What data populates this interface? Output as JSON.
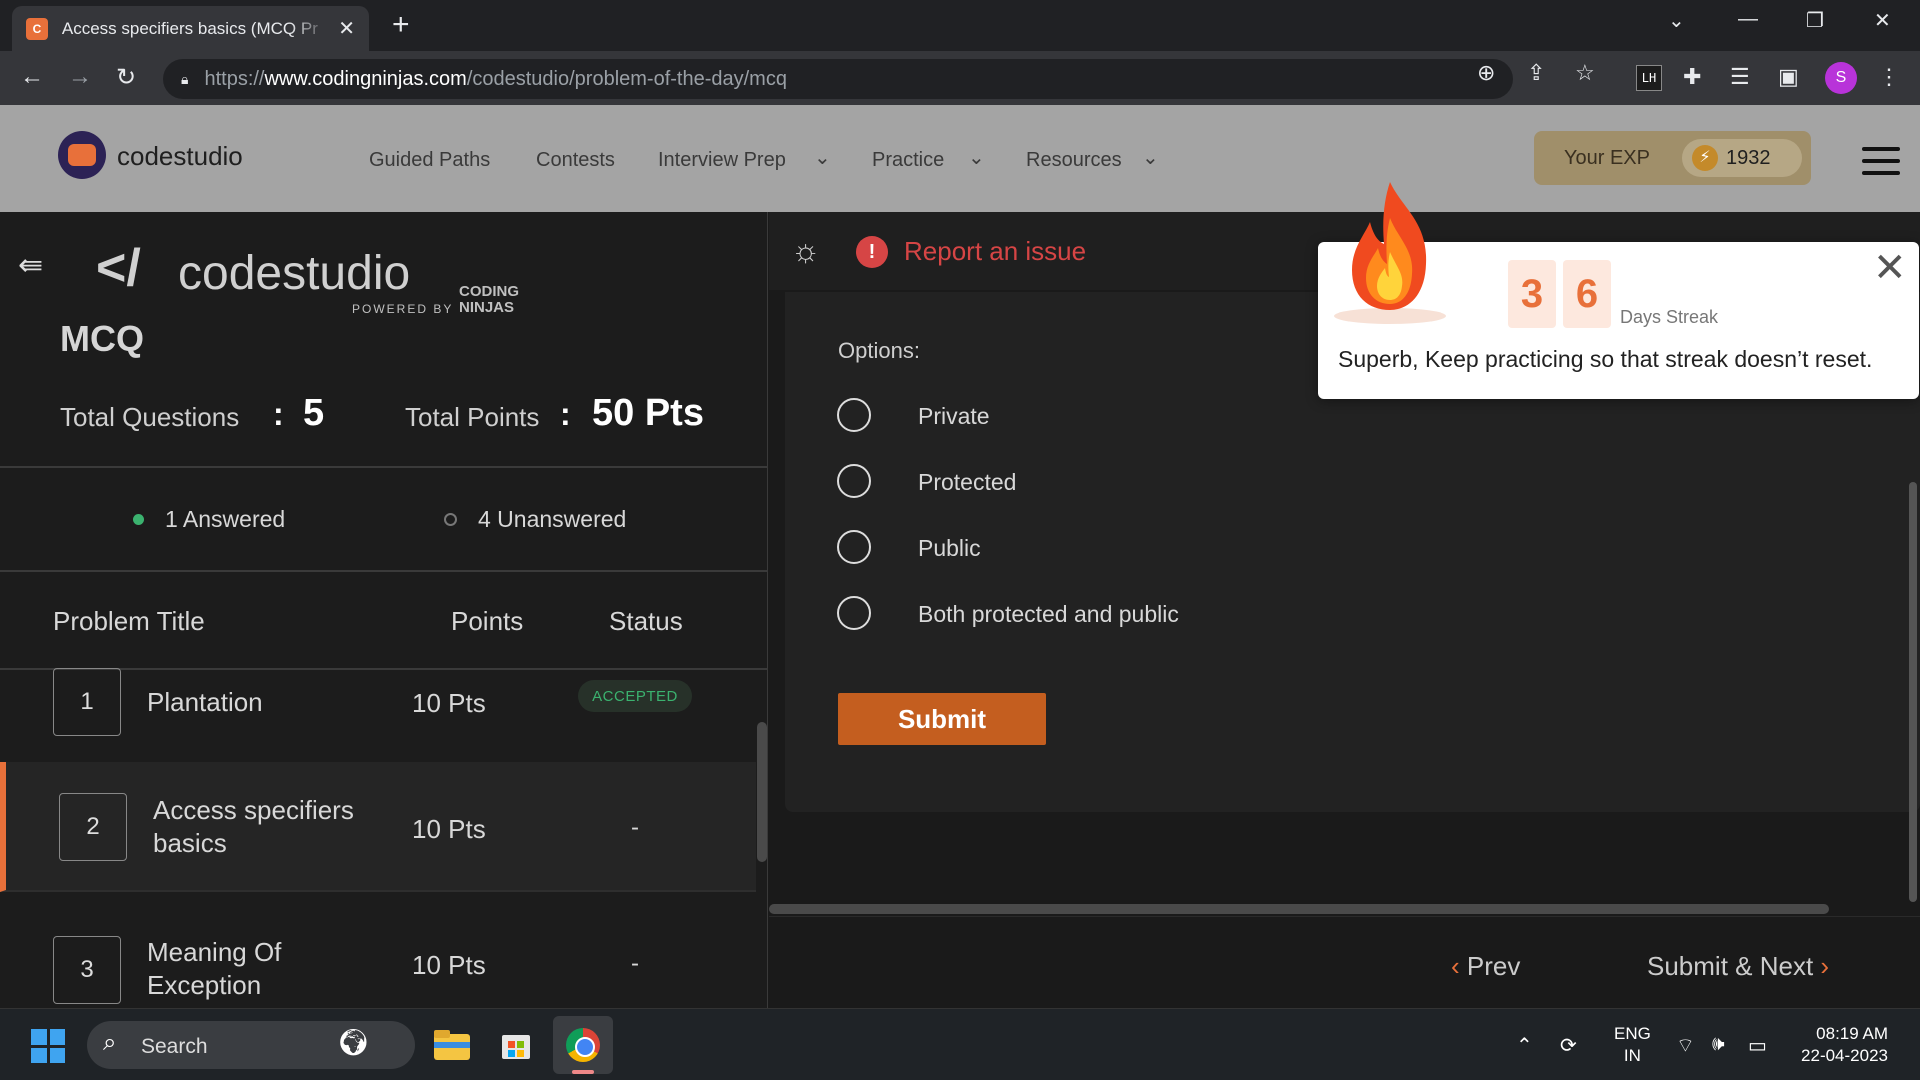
{
  "browser": {
    "tab_title": "Access specifiers basics (MCQ Pr",
    "url_scheme": "https://",
    "url_host": "www.codingninjas.com",
    "url_path": "/codestudio/problem-of-the-day/mcq",
    "ext_lh": "LH",
    "profile_initial": "S"
  },
  "header": {
    "logo_text": "codestudio",
    "nav": [
      "Guided Paths",
      "Contests",
      "Interview Prep",
      "Practice",
      "Resources"
    ],
    "exp_label": "Your EXP",
    "exp_value": "1932"
  },
  "left": {
    "brand_name": "codestudio",
    "powered_by": "POWERED BY",
    "cn_line1": "CODING",
    "cn_line2": "NINJAS",
    "title": "MCQ",
    "total_questions_label": "Total Questions",
    "total_questions_value": "5",
    "total_points_label": "Total Points",
    "total_points_value": "50 Pts",
    "answered": "1 Answered",
    "unanswered": "4 Unanswered",
    "columns": {
      "title": "Problem Title",
      "points": "Points",
      "status": "Status"
    },
    "problems": [
      {
        "num": "1",
        "title": "Plantation",
        "points": "10 Pts",
        "status": "ACCEPTED"
      },
      {
        "num": "2",
        "title": "Access specifiers basics",
        "points": "10 Pts",
        "status": "-"
      },
      {
        "num": "3",
        "title": "Meaning Of Exception",
        "points": "10 Pts",
        "status": "-"
      }
    ]
  },
  "question": {
    "report_label": "Report an issue",
    "options_label": "Options:",
    "options": [
      "Private",
      "Protected",
      "Public",
      "Both protected and public"
    ],
    "submit_label": "Submit",
    "prev_label": "Prev",
    "next_label": "Submit & Next"
  },
  "streak": {
    "digits": [
      "3",
      "6"
    ],
    "label": "Days Streak",
    "message": "Superb, Keep practicing so that streak doesn’t reset."
  },
  "taskbar": {
    "search_label": "Search",
    "lang_line1": "ENG",
    "lang_line2": "IN",
    "time": "08:19 AM",
    "date": "22-04-2023"
  },
  "colors": {
    "accent": "#e8703a",
    "report": "#d64545",
    "accepted": "#3bb26f"
  }
}
